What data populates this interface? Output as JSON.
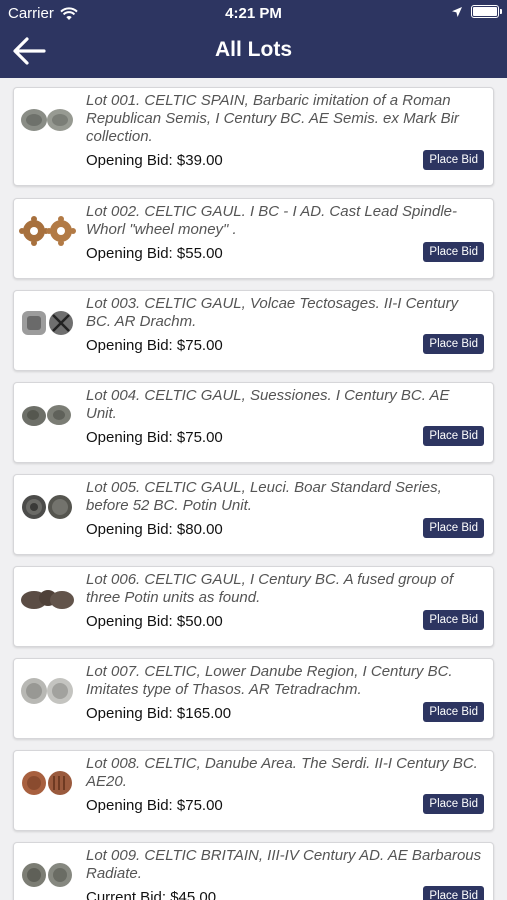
{
  "status_bar": {
    "carrier": "Carrier",
    "time": "4:21 PM"
  },
  "header": {
    "title": "All Lots"
  },
  "lots": [
    {
      "description": "Lot 001. CELTIC SPAIN, Barbaric imitation of a Roman Republican Semis, I Century BC. AE Semis. ex Mark Bir collection.",
      "bid": "Opening Bid: $39.00",
      "button": "Place Bid"
    },
    {
      "description": "Lot 002. CELTIC GAUL. I BC - I AD. Cast Lead Spindle-Whorl \"wheel money\" .",
      "bid": "Opening Bid: $55.00",
      "button": "Place Bid"
    },
    {
      "description": "Lot 003. CELTIC GAUL, Volcae Tectosages. II-I Century BC. AR Drachm.",
      "bid": "Opening Bid: $75.00",
      "button": "Place Bid"
    },
    {
      "description": "Lot 004. CELTIC GAUL, Suessiones. I Century BC. AE Unit.",
      "bid": "Opening Bid: $75.00",
      "button": "Place Bid"
    },
    {
      "description": "Lot 005. CELTIC GAUL, Leuci. Boar Standard Series, before 52 BC. Potin Unit.",
      "bid": "Opening Bid: $80.00",
      "button": "Place Bid"
    },
    {
      "description": "Lot 006. CELTIC GAUL, I Century BC. A fused group of three Potin units as found.",
      "bid": "Opening Bid: $50.00",
      "button": "Place Bid"
    },
    {
      "description": "Lot 007. CELTIC, Lower Danube Region, I Century BC. Imitates type of Thasos. AR Tetradrachm.",
      "bid": "Opening Bid: $165.00",
      "button": "Place Bid"
    },
    {
      "description": "Lot 008. CELTIC, Danube Area. The Serdi. II-I Century BC. AE20.",
      "bid": "Opening Bid: $75.00",
      "button": "Place Bid"
    },
    {
      "description": "Lot 009. CELTIC BRITAIN, III-IV Century AD. AE Barbarous Radiate.",
      "bid": "Current Bid: $45.00",
      "button": "Place Bid"
    }
  ],
  "colors": {
    "header": "#2d3561",
    "button": "#2d3561"
  }
}
